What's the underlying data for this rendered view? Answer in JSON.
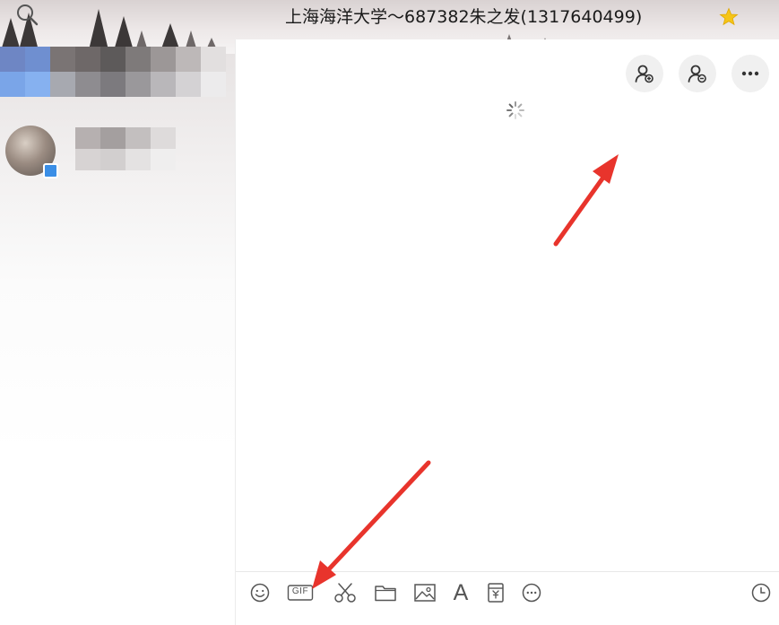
{
  "window": {
    "title": "上海海洋大学～687382朱之发(1317640499)"
  },
  "icons": {
    "search": "search-icon",
    "favorite": "star-icon",
    "add_member": "add-member-icon",
    "group_member": "group-member-icon",
    "more": "more-icon",
    "loading": "loading-spinner-icon",
    "emoji": "emoji-icon",
    "gif": "gif-icon",
    "screenshot": "scissors-icon",
    "file": "folder-icon",
    "image": "image-icon",
    "font": "font-icon",
    "red_packet": "red-packet-icon",
    "more_tools": "more-tools-icon",
    "history": "clock-icon"
  },
  "toolbar": {
    "gif_label": "GIF",
    "font_label": "A"
  },
  "colors": {
    "annotation_arrow": "#e8342c",
    "favorite_star": "#f5c518",
    "unread_badge": "#3a8ee6"
  }
}
